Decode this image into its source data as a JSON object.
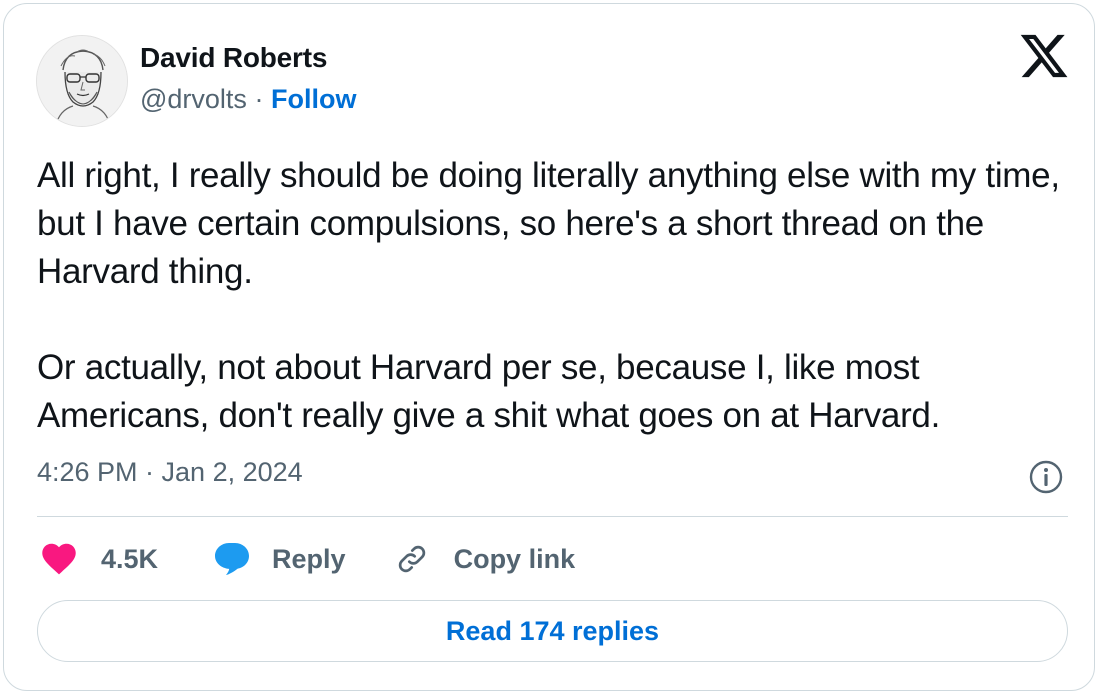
{
  "author": {
    "name": "David Roberts",
    "handle": "@drvolts",
    "separator": "·",
    "follow_label": "Follow",
    "avatar_icon": "portrait-sketch"
  },
  "brand_icon": "x-logo-icon",
  "tweet": {
    "paragraphs": [
      "All right, I really should be doing literally anything else with my time, but I have certain compulsions, so here's a short thread on the Harvard thing.",
      "Or actually, not about Harvard per se, because I, like most Americans, don't really give a shit what goes on at Harvard."
    ],
    "timestamp": "4:26 PM · Jan 2, 2024",
    "info_icon": "info-icon"
  },
  "actions": {
    "like_count": "4.5K",
    "reply_label": "Reply",
    "copy_link_label": "Copy link",
    "read_replies_label": "Read 174 replies"
  },
  "colors": {
    "like": "#f91880",
    "reply": "#1d9bf0",
    "link": "#006fd6",
    "muted": "#536471",
    "border": "#cfd9de"
  }
}
